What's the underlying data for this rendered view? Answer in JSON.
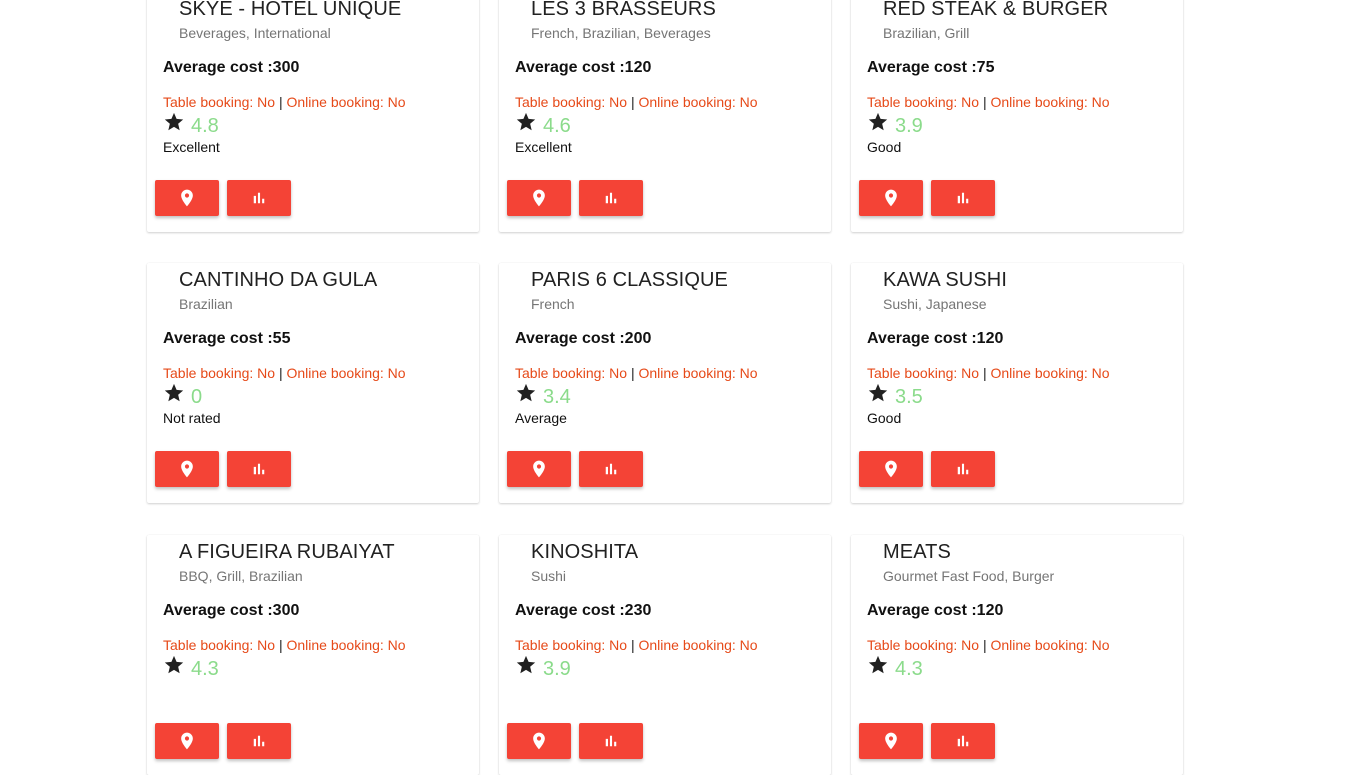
{
  "colors": {
    "button": "#f44336",
    "booking_text": "#e64a19",
    "rating_value": "#8bdb8b",
    "cuisine_text": "#757575"
  },
  "icons": {
    "star": "star-icon",
    "location": "location-pin-icon",
    "stats": "bar-chart-icon"
  },
  "restaurants": [
    {
      "name": "SKYE - HOTEL UNIQUE",
      "cuisines": "Beverages, International",
      "cost_label": "Average cost :",
      "cost": "300",
      "table_booking": "Table booking: No",
      "separator": "|",
      "online_booking": "Online booking: No",
      "rating": "4.8",
      "rating_text": "Excellent"
    },
    {
      "name": "LES 3 BRASSEURS",
      "cuisines": "French, Brazilian, Beverages",
      "cost_label": "Average cost :",
      "cost": "120",
      "table_booking": "Table booking: No",
      "separator": "|",
      "online_booking": "Online booking: No",
      "rating": "4.6",
      "rating_text": "Excellent"
    },
    {
      "name": "RED STEAK & BURGER",
      "cuisines": "Brazilian, Grill",
      "cost_label": "Average cost :",
      "cost": "75",
      "table_booking": "Table booking: No",
      "separator": "|",
      "online_booking": "Online booking: No",
      "rating": "3.9",
      "rating_text": "Good"
    },
    {
      "name": "CANTINHO DA GULA",
      "cuisines": "Brazilian",
      "cost_label": "Average cost :",
      "cost": "55",
      "table_booking": "Table booking: No",
      "separator": "|",
      "online_booking": "Online booking: No",
      "rating": "0",
      "rating_text": "Not rated"
    },
    {
      "name": "PARIS 6 CLASSIQUE",
      "cuisines": "French",
      "cost_label": "Average cost :",
      "cost": "200",
      "table_booking": "Table booking: No",
      "separator": "|",
      "online_booking": "Online booking: No",
      "rating": "3.4",
      "rating_text": "Average"
    },
    {
      "name": "KAWA SUSHI",
      "cuisines": "Sushi, Japanese",
      "cost_label": "Average cost :",
      "cost": "120",
      "table_booking": "Table booking: No",
      "separator": "|",
      "online_booking": "Online booking: No",
      "rating": "3.5",
      "rating_text": "Good"
    },
    {
      "name": "A FIGUEIRA RUBAIYAT",
      "cuisines": "BBQ, Grill, Brazilian",
      "cost_label": "Average cost :",
      "cost": "300",
      "table_booking": "Table booking: No",
      "separator": "|",
      "online_booking": "Online booking: No",
      "rating": "4.3",
      "rating_text": ""
    },
    {
      "name": "KINOSHITA",
      "cuisines": "Sushi",
      "cost_label": "Average cost :",
      "cost": "230",
      "table_booking": "Table booking: No",
      "separator": "|",
      "online_booking": "Online booking: No",
      "rating": "3.9",
      "rating_text": ""
    },
    {
      "name": "MEATS",
      "cuisines": "Gourmet Fast Food, Burger",
      "cost_label": "Average cost :",
      "cost": "120",
      "table_booking": "Table booking: No",
      "separator": "|",
      "online_booking": "Online booking: No",
      "rating": "4.3",
      "rating_text": ""
    }
  ]
}
